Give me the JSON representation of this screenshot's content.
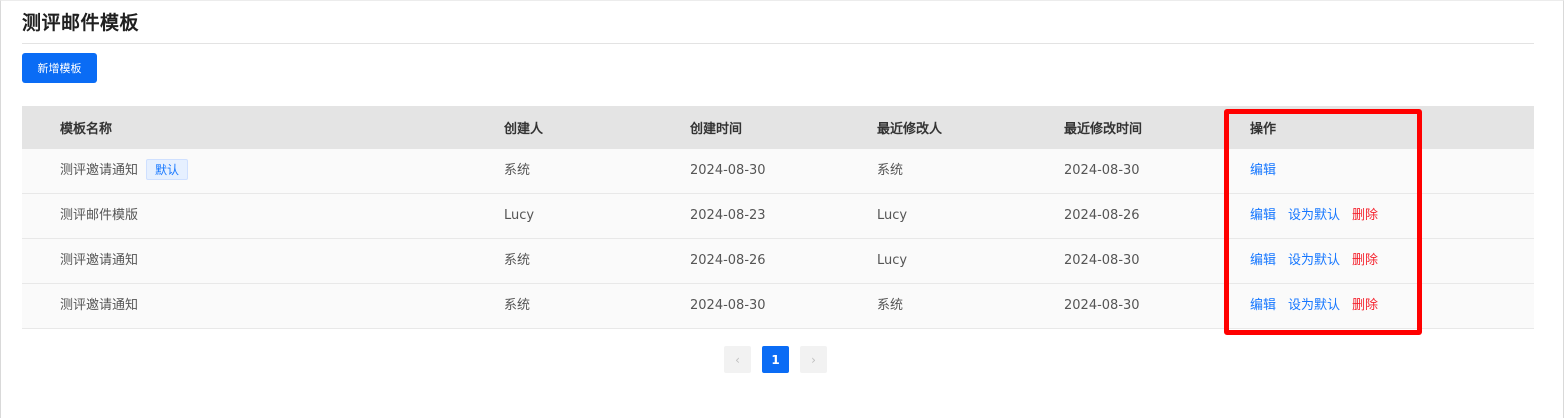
{
  "page": {
    "title": "测评邮件模板"
  },
  "toolbar": {
    "add_label": "新增模板"
  },
  "table": {
    "headers": [
      "模板名称",
      "创建人",
      "创建时间",
      "最近修改人",
      "最近修改时间",
      "操作"
    ],
    "rows": [
      {
        "name": "测评邀请通知",
        "badge": "默认",
        "creator": "系统",
        "created": "2024-08-30",
        "modifier": "系统",
        "modified": "2024-08-30",
        "actions": [
          "编辑"
        ]
      },
      {
        "name": "测评邮件模版",
        "badge": "",
        "creator": "Lucy",
        "created": "2024-08-23",
        "modifier": "Lucy",
        "modified": "2024-08-26",
        "actions": [
          "编辑",
          "设为默认",
          "删除"
        ]
      },
      {
        "name": "测评邀请通知",
        "badge": "",
        "creator": "系统",
        "created": "2024-08-26",
        "modifier": "Lucy",
        "modified": "2024-08-30",
        "actions": [
          "编辑",
          "设为默认",
          "删除"
        ]
      },
      {
        "name": "测评邀请通知",
        "badge": "",
        "creator": "系统",
        "created": "2024-08-30",
        "modifier": "系统",
        "modified": "2024-08-30",
        "actions": [
          "编辑",
          "设为默认",
          "删除"
        ]
      }
    ]
  },
  "pagination": {
    "prev": "‹",
    "current": "1",
    "next": "›"
  },
  "colors": {
    "primary": "#0a6cf5",
    "danger": "#f5222d",
    "highlight": "#ff0000"
  }
}
